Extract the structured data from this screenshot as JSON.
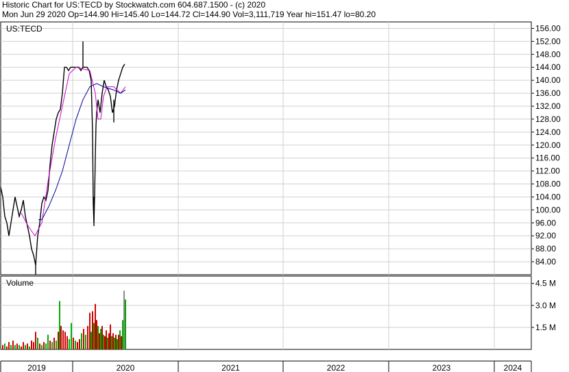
{
  "header": {
    "line1": "Historic Chart for US:TECD by Stockwatch.com 604.687.1500 - (c) 2020",
    "line2": "Mon Jun 29 2020   Op=144.90   Hi=145.40   Lo=144.72   Cl=144.90   Vol=3,111,719   Year hi=151.47   lo=80.20"
  },
  "chart_data": [
    {
      "type": "line",
      "title": "US:TECD",
      "ylim": [
        80,
        158
      ],
      "y_ticks": [
        "156.00",
        "152.00",
        "148.00",
        "144.00",
        "140.00",
        "136.00",
        "132.00",
        "128.00",
        "124.00",
        "120.00",
        "116.00",
        "112.00",
        "108.00",
        "104.00",
        "100.00",
        "96.00",
        "92.00",
        "88.00",
        "84.00"
      ],
      "x_labels": [
        "2019",
        "2020",
        "2021",
        "2022",
        "2023",
        "2024"
      ],
      "grid": true,
      "colors": {
        "price": "#000000",
        "ma_short": "#cc00cc",
        "ma_long": "#000099"
      },
      "series": [
        {
          "role": "price",
          "points": [
            [
              0,
              107
            ],
            [
              3,
              104
            ],
            [
              6,
              98
            ],
            [
              9,
              96
            ],
            [
              12,
              92
            ],
            [
              15,
              96
            ],
            [
              18,
              100
            ],
            [
              21,
              104
            ],
            [
              24,
              101
            ],
            [
              27,
              98
            ],
            [
              30,
              100
            ],
            [
              33,
              103
            ],
            [
              36,
              98
            ],
            [
              39,
              95
            ],
            [
              42,
              92
            ],
            [
              45,
              88
            ],
            [
              48,
              86
            ],
            [
              51,
              83
            ],
            [
              54,
              92
            ],
            [
              57,
              96
            ],
            [
              60,
              102
            ],
            [
              63,
              104
            ],
            [
              66,
              103
            ],
            [
              69,
              106
            ],
            [
              72,
              114
            ],
            [
              75,
              120
            ],
            [
              78,
              124
            ],
            [
              81,
              128
            ],
            [
              84,
              130
            ],
            [
              87,
              131
            ],
            [
              90,
              136
            ],
            [
              93,
              144
            ],
            [
              96,
              144
            ],
            [
              99,
              143
            ],
            [
              102,
              144
            ],
            [
              105,
              144
            ],
            [
              108,
              144
            ],
            [
              111,
              144
            ],
            [
              114,
              144
            ],
            [
              117,
              143
            ],
            [
              120,
              144
            ],
            [
              123,
              144
            ],
            [
              126,
              144
            ],
            [
              129,
              143
            ],
            [
              132,
              140
            ],
            [
              134,
              124
            ],
            [
              135,
              102
            ],
            [
              136,
              96
            ],
            [
              137,
              104
            ],
            [
              138,
              116
            ],
            [
              139,
              126
            ],
            [
              140,
              130
            ],
            [
              142,
              134
            ],
            [
              145,
              130
            ],
            [
              148,
              136
            ],
            [
              151,
              140
            ],
            [
              154,
              138
            ],
            [
              157,
              137
            ],
            [
              160,
              135
            ],
            [
              163,
              130
            ],
            [
              166,
              132
            ],
            [
              169,
              137
            ],
            [
              172,
              140
            ],
            [
              175,
              142
            ],
            [
              178,
              144
            ],
            [
              181,
              145
            ]
          ],
          "spikes": [
            [
              120,
              144,
              152
            ],
            [
              136,
              95,
              104
            ],
            [
              51,
              80,
              84
            ],
            [
              165,
              127,
              134
            ]
          ]
        },
        {
          "role": "ma_short",
          "points": [
            [
              30,
              99
            ],
            [
              40,
              95
            ],
            [
              50,
              92
            ],
            [
              60,
              96
            ],
            [
              70,
              110
            ],
            [
              80,
              122
            ],
            [
              90,
              132
            ],
            [
              100,
              142
            ],
            [
              110,
              144
            ],
            [
              130,
              143
            ],
            [
              138,
              136
            ],
            [
              142,
              128
            ],
            [
              146,
              128
            ],
            [
              150,
              135
            ],
            [
              155,
              138
            ],
            [
              165,
              138
            ],
            [
              170,
              137
            ],
            [
              175,
              136
            ],
            [
              182,
              138
            ]
          ]
        },
        {
          "role": "ma_long",
          "points": [
            [
              55,
              97
            ],
            [
              60,
              97
            ],
            [
              70,
              101
            ],
            [
              80,
              106
            ],
            [
              90,
              112
            ],
            [
              100,
              120
            ],
            [
              110,
              128
            ],
            [
              120,
              134
            ],
            [
              130,
              138
            ],
            [
              140,
              139
            ],
            [
              150,
              138
            ],
            [
              165,
              137
            ],
            [
              175,
              136
            ],
            [
              182,
              137
            ]
          ]
        }
      ]
    },
    {
      "type": "bar",
      "title": "Volume",
      "y_ticks": [
        "4.5 M",
        "3.0 M",
        "1.5 M"
      ],
      "ylim": [
        0,
        5.0
      ],
      "unit": "M",
      "colors": {
        "up": "#00aa00",
        "down": "#cc0000",
        "flat": "#888888"
      },
      "bars": [
        [
          2,
          0.3,
          "d"
        ],
        [
          5,
          0.4,
          "u"
        ],
        [
          8,
          0.2,
          "d"
        ],
        [
          11,
          0.5,
          "d"
        ],
        [
          14,
          0.3,
          "u"
        ],
        [
          17,
          0.6,
          "d"
        ],
        [
          20,
          0.3,
          "u"
        ],
        [
          23,
          0.4,
          "d"
        ],
        [
          26,
          0.3,
          "u"
        ],
        [
          29,
          0.2,
          "d"
        ],
        [
          32,
          0.5,
          "d"
        ],
        [
          35,
          0.3,
          "u"
        ],
        [
          38,
          0.4,
          "d"
        ],
        [
          41,
          0.2,
          "u"
        ],
        [
          44,
          0.6,
          "d"
        ],
        [
          47,
          0.5,
          "d"
        ],
        [
          50,
          1.2,
          "d"
        ],
        [
          53,
          0.8,
          "u"
        ],
        [
          56,
          0.4,
          "d"
        ],
        [
          59,
          0.3,
          "u"
        ],
        [
          62,
          0.5,
          "d"
        ],
        [
          65,
          0.4,
          "u"
        ],
        [
          68,
          1.0,
          "u"
        ],
        [
          71,
          0.6,
          "d"
        ],
        [
          74,
          0.5,
          "u"
        ],
        [
          77,
          0.8,
          "d"
        ],
        [
          80,
          0.6,
          "u"
        ],
        [
          83,
          1.2,
          "d"
        ],
        [
          85,
          3.3,
          "u"
        ],
        [
          87,
          1.6,
          "d"
        ],
        [
          90,
          1.3,
          "d"
        ],
        [
          93,
          1.2,
          "d"
        ],
        [
          96,
          0.9,
          "d"
        ],
        [
          99,
          0.7,
          "u"
        ],
        [
          102,
          1.8,
          "u"
        ],
        [
          105,
          0.8,
          "d"
        ],
        [
          108,
          0.6,
          "u"
        ],
        [
          111,
          0.5,
          "d"
        ],
        [
          114,
          0.7,
          "d"
        ],
        [
          117,
          1.1,
          "u"
        ],
        [
          120,
          1.4,
          "d"
        ],
        [
          123,
          1.0,
          "u"
        ],
        [
          126,
          1.6,
          "d"
        ],
        [
          129,
          2.5,
          "d"
        ],
        [
          131,
          1.2,
          "u"
        ],
        [
          133,
          2.6,
          "d"
        ],
        [
          135,
          1.8,
          "u"
        ],
        [
          137,
          3.1,
          "d"
        ],
        [
          139,
          2.0,
          "d"
        ],
        [
          141,
          1.6,
          "u"
        ],
        [
          143,
          1.1,
          "d"
        ],
        [
          145,
          1.4,
          "u"
        ],
        [
          147,
          1.6,
          "d"
        ],
        [
          149,
          1.0,
          "u"
        ],
        [
          151,
          0.9,
          "d"
        ],
        [
          153,
          1.3,
          "d"
        ],
        [
          155,
          0.8,
          "u"
        ],
        [
          157,
          1.1,
          "d"
        ],
        [
          159,
          1.7,
          "d"
        ],
        [
          161,
          0.9,
          "u"
        ],
        [
          163,
          1.1,
          "d"
        ],
        [
          165,
          0.8,
          "u"
        ],
        [
          167,
          1.0,
          "d"
        ],
        [
          169,
          0.7,
          "u"
        ],
        [
          171,
          1.0,
          "d"
        ],
        [
          173,
          1.3,
          "u"
        ],
        [
          175,
          0.9,
          "d"
        ],
        [
          177,
          2.0,
          "u"
        ],
        [
          179,
          4.0,
          "n"
        ],
        [
          181,
          3.4,
          "u"
        ]
      ]
    }
  ]
}
